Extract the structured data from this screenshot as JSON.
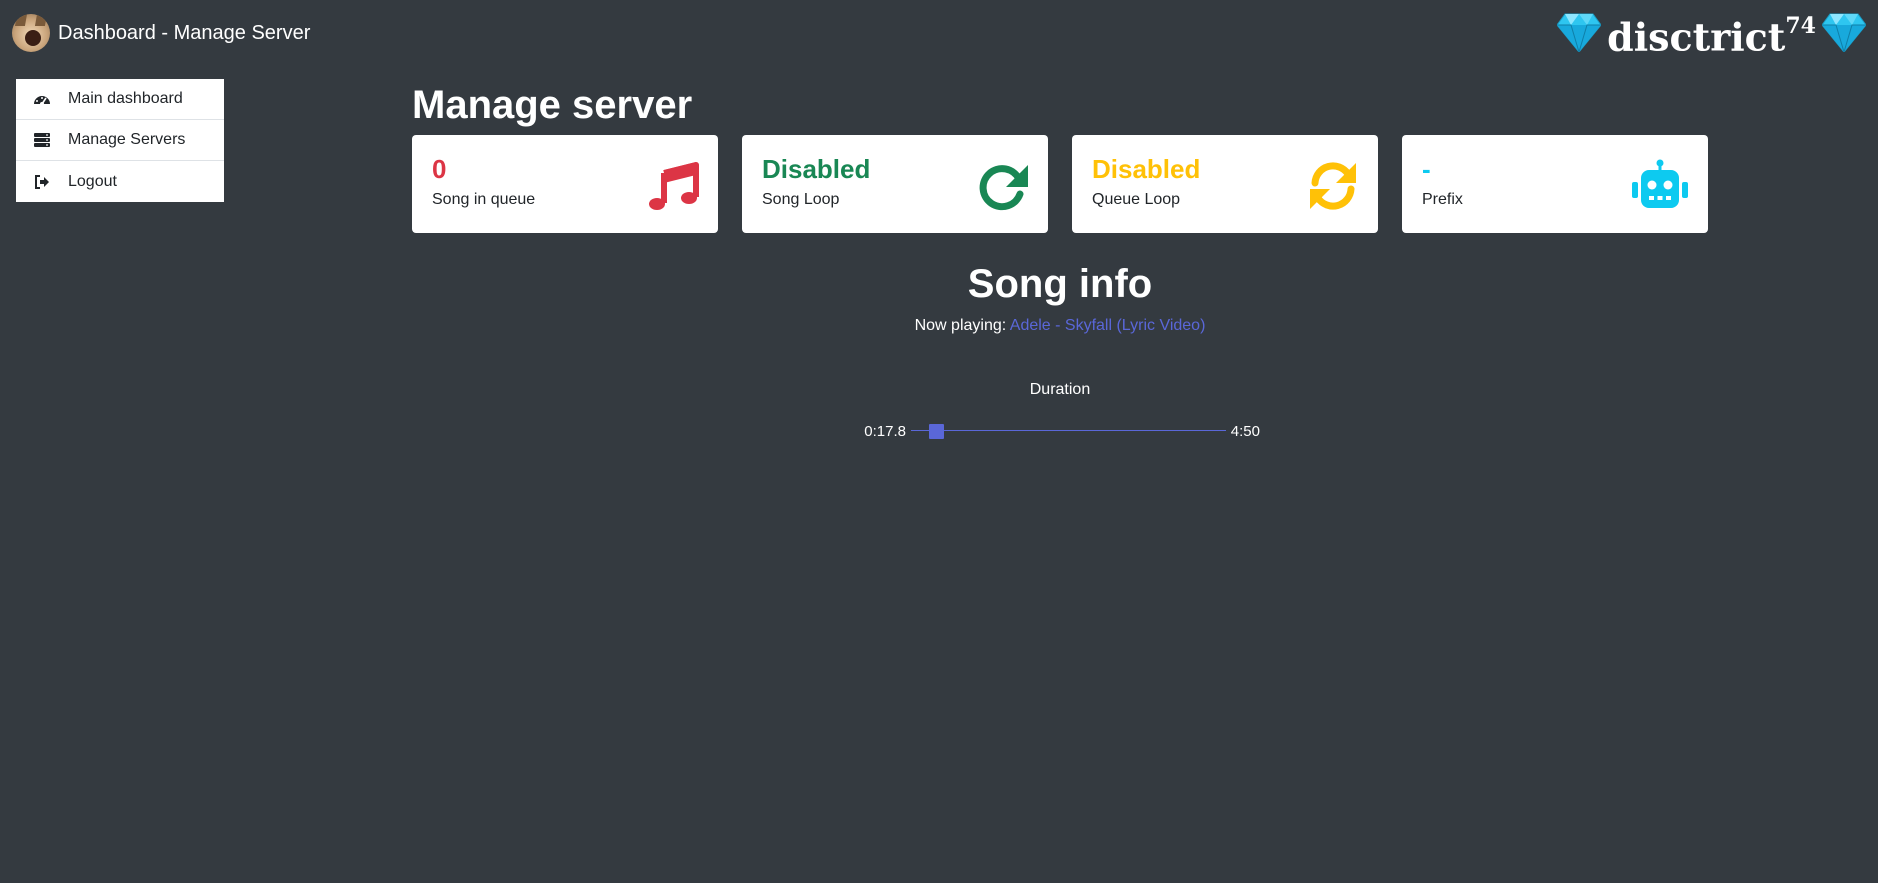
{
  "header": {
    "title": "Dashboard - Manage Server",
    "logo": {
      "text": "disctrict",
      "superscript": "74",
      "gem_color": "#2ec6f0"
    }
  },
  "sidebar": {
    "items": [
      {
        "label": "Main dashboard",
        "icon": "tachometer-icon"
      },
      {
        "label": "Manage Servers",
        "icon": "server-icon"
      },
      {
        "label": "Logout",
        "icon": "sign-out-icon"
      }
    ]
  },
  "main": {
    "title": "Manage server",
    "cards": [
      {
        "value": "0",
        "label": "Song in queue",
        "color": "#dc3545",
        "icon": "music-icon"
      },
      {
        "value": "Disabled",
        "label": "Song Loop",
        "color": "#198754",
        "icon": "redo-icon"
      },
      {
        "value": "Disabled",
        "label": "Queue Loop",
        "color": "#ffc107",
        "icon": "sync-icon"
      },
      {
        "value": "-",
        "label": "Prefix",
        "color": "#0dcaf0",
        "icon": "robot-icon"
      }
    ],
    "song_info": {
      "title": "Song info",
      "now_playing_label": "Now playing:",
      "song_title": "Adele - Skyfall (Lyric Video)",
      "duration_label": "Duration",
      "elapsed": "0:17.8",
      "total": "4:50",
      "progress_fraction": 0.061,
      "accent_color": "#5a67d8"
    }
  }
}
